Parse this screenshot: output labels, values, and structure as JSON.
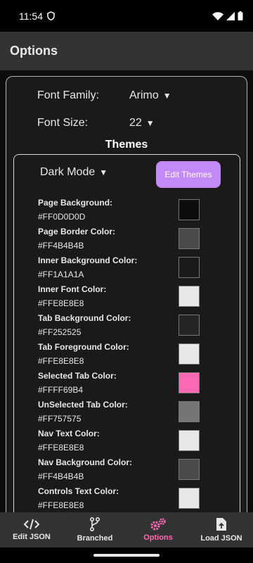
{
  "status_bar": {
    "time": "11:54"
  },
  "app_bar": {
    "title": "Options"
  },
  "settings": {
    "font_family_label": "Font Family:",
    "font_family_value": "Arimo",
    "font_size_label": "Font Size:",
    "font_size_value": "22"
  },
  "themes": {
    "title": "Themes",
    "mode_value": "Dark Mode",
    "edit_button_label": "Edit Themes",
    "colors": [
      {
        "label": "Page Background:",
        "value": "#FF0D0D0D",
        "swatch": "#0d0d0d"
      },
      {
        "label": "Page Border Color:",
        "value": "#FF4B4B4B",
        "swatch": "#4b4b4b"
      },
      {
        "label": "Inner Background Color:",
        "value": "#FF1A1A1A",
        "swatch": "#1a1a1a"
      },
      {
        "label": "Inner Font Color:",
        "value": "#FFE8E8E8",
        "swatch": "#e8e8e8"
      },
      {
        "label": "Tab Background Color:",
        "value": "#FF252525",
        "swatch": "#252525"
      },
      {
        "label": "Tab Foreground Color:",
        "value": "#FFE8E8E8",
        "swatch": "#e8e8e8"
      },
      {
        "label": "Selected Tab Color:",
        "value": "#FFFF69B4",
        "swatch": "#ff69b4"
      },
      {
        "label": "UnSelected Tab Color:",
        "value": "#FF757575",
        "swatch": "#757575"
      },
      {
        "label": "Nav Text Color:",
        "value": "#FFE8E8E8",
        "swatch": "#e8e8e8"
      },
      {
        "label": "Nav Background Color:",
        "value": "#FF4B4B4B",
        "swatch": "#4b4b4b"
      },
      {
        "label": "Controls Text Color:",
        "value": "#FFE8E8E8",
        "swatch": "#e8e8e8"
      }
    ]
  },
  "bottom_nav": {
    "items": [
      {
        "label": "Edit JSON",
        "icon": "code-icon"
      },
      {
        "label": "Branched",
        "icon": "branch-icon"
      },
      {
        "label": "Options",
        "icon": "gears-icon"
      },
      {
        "label": "Load JSON",
        "icon": "file-upload-icon"
      }
    ]
  },
  "colors": {
    "accent": "#ff69b4",
    "button": "#c38af7"
  }
}
